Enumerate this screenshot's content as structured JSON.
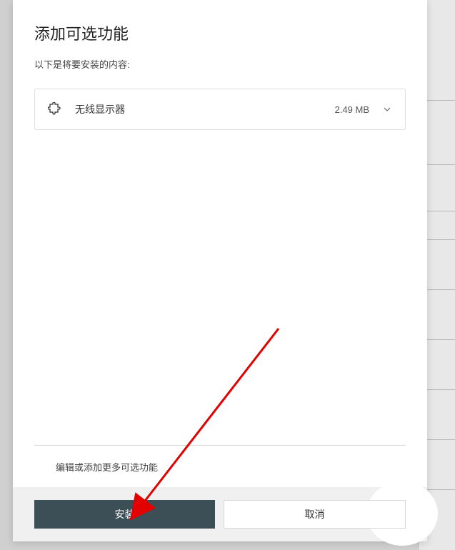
{
  "dialog": {
    "title": "添加可选功能",
    "subtitle": "以下是将要安装的内容:"
  },
  "features": [
    {
      "name": "无线显示器",
      "size": "2.49 MB"
    }
  ],
  "editLink": "编辑或添加更多可选功能",
  "buttons": {
    "install": "安装",
    "cancel": "取消"
  }
}
